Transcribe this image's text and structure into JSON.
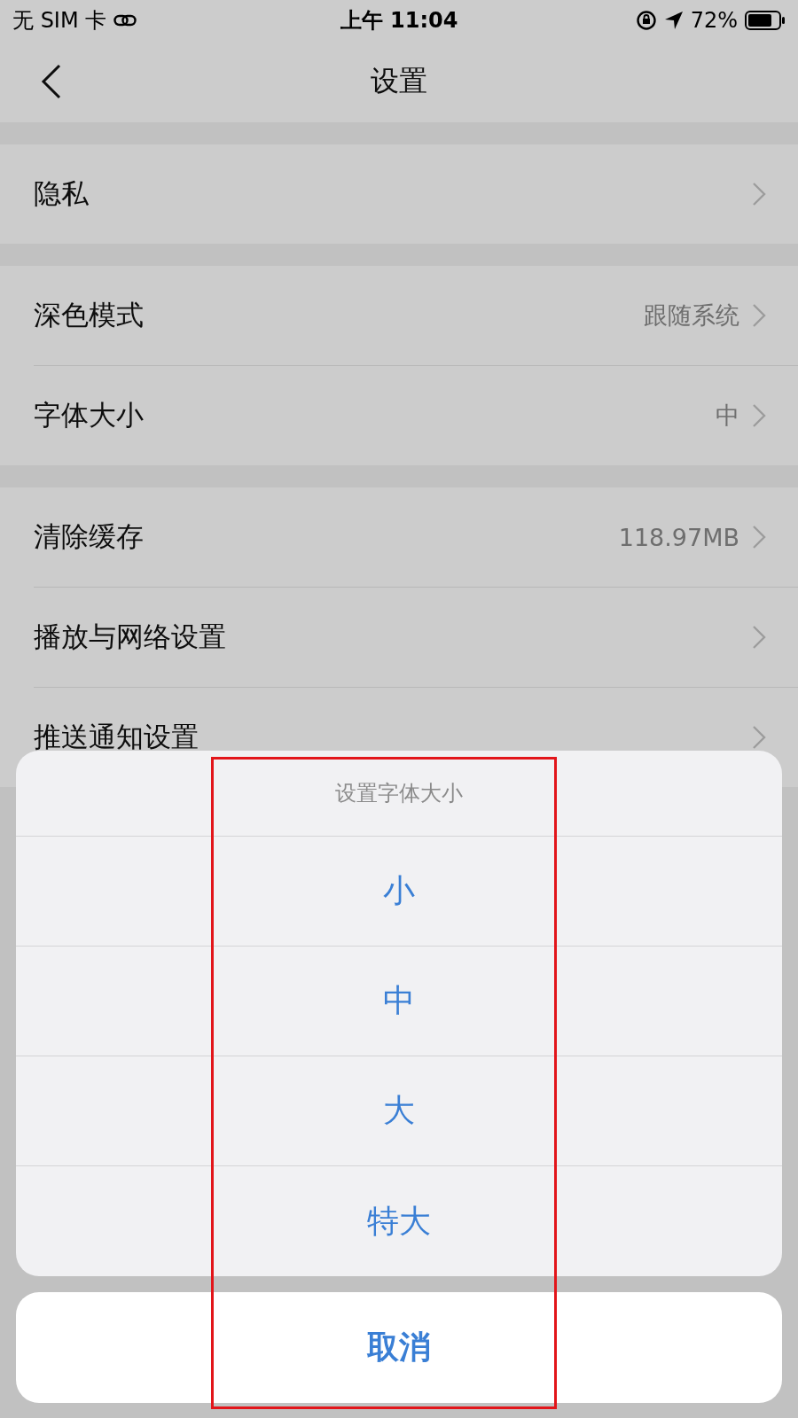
{
  "status_bar": {
    "carrier": "无 SIM 卡",
    "time": "上午 11:04",
    "battery": "72%"
  },
  "nav": {
    "title": "设置"
  },
  "groups": [
    {
      "items": [
        {
          "label": "隐私"
        }
      ]
    },
    {
      "items": [
        {
          "label": "深色模式",
          "value": "跟随系统"
        },
        {
          "label": "字体大小",
          "value": "中"
        }
      ]
    },
    {
      "items": [
        {
          "label": "清除缓存",
          "value": "118.97MB"
        },
        {
          "label": "播放与网络设置"
        },
        {
          "label": "推送通知设置"
        }
      ]
    }
  ],
  "action_sheet": {
    "title": "设置字体大小",
    "options": [
      "小",
      "中",
      "大",
      "特大"
    ],
    "cancel": "取消"
  }
}
